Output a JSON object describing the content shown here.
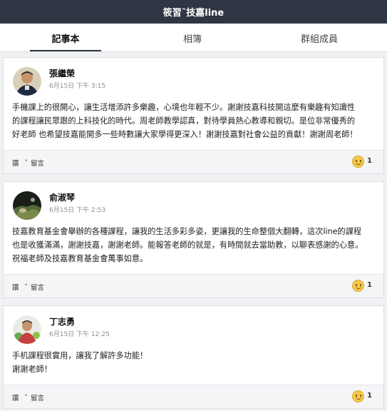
{
  "header": {
    "title": "筱習˜技嘉line"
  },
  "tabs": [
    {
      "label": "記事本"
    },
    {
      "label": "相簿"
    },
    {
      "label": "群組成員"
    }
  ],
  "posts": [
    {
      "author": "張繼榮",
      "time": "6月15日 下午 3:15",
      "text": "手機課上的很開心，讓生活增添許多樂趣，心境也年輕不少。謝謝技嘉科技開這麼有樂趣有知識性\n的課程讓民眾跟的上科技化的時代。周老師教學認真，對待學員熱心教導和親切。是位非常優秀的\n好老師 也希望技嘉能開多一些時數讓大家學得更深入！謝謝技嘉對社會公益的貢獻！謝謝周老師！",
      "like_label": "讚",
      "comment_label": "留言",
      "likes": "1"
    },
    {
      "author": "俞淑琴",
      "time": "6月15日 下午 2:53",
      "text": "技嘉教育基金會舉辦的各種課程，讓我的生活多彩多姿，更讓我的生命整個大翻轉，這次line的課程\n也是收獲滿滿，謝謝技嘉，謝謝老師。能報答老師的就是，有時間就去當助教，以聊表感謝的心意。\n祝福老師及技嘉教育基金會萬事如意。",
      "like_label": "讚",
      "comment_label": "留言",
      "likes": "1"
    },
    {
      "author": "丁志勇",
      "time": "6月15日 下午 12:25",
      "text": "手机課程很實用，讓我了解許多功能！\n謝謝老師！",
      "like_label": "讚",
      "comment_label": "留言",
      "likes": "1"
    }
  ],
  "colors": {
    "header_bg": "#2f3643",
    "emoji": "#f6c84a"
  }
}
